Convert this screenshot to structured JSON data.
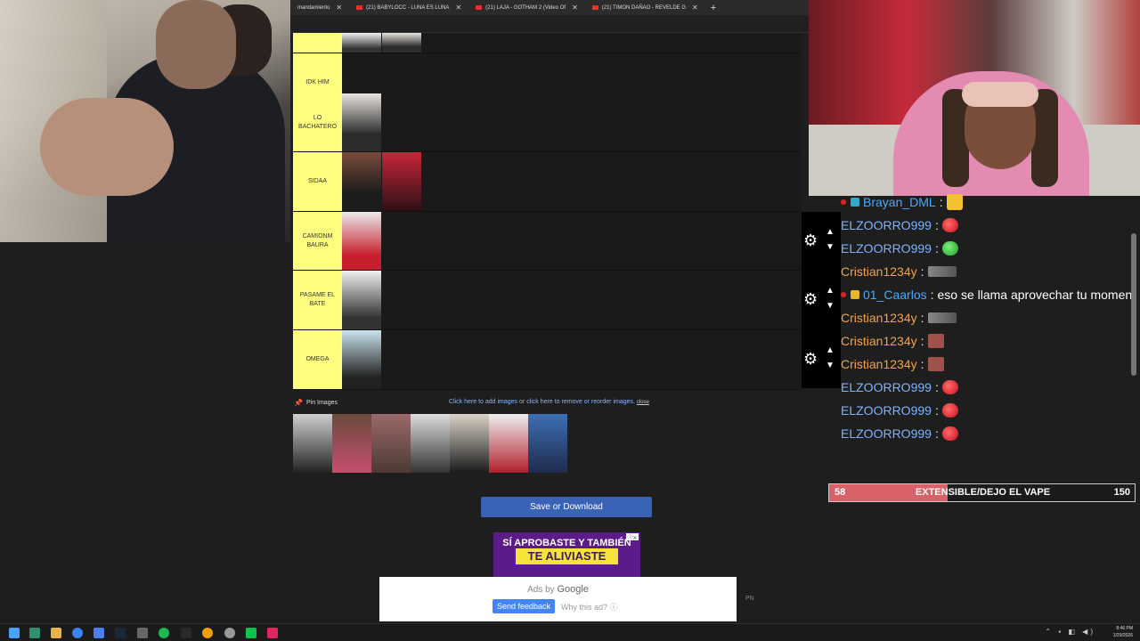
{
  "browser": {
    "tabs": [
      {
        "label": "mandamiento",
        "close": "✕"
      },
      {
        "label": "(21) BABYLOCC - LUNA ES LUNA",
        "close": "✕"
      },
      {
        "label": "(21) LAJA - GOTHAM 2 (Video Of",
        "close": "✕"
      },
      {
        "label": "(21) TIMON DAÑAO - REVELDE G",
        "close": "✕"
      }
    ],
    "new_tab": "+"
  },
  "tierlist": {
    "tiers": [
      {
        "label": ""
      },
      {
        "label": "IDK HIM"
      },
      {
        "label": "LO BACHATERO"
      },
      {
        "label": "SIDAA"
      },
      {
        "label": "CAMIONM BAURA"
      },
      {
        "label": "PASAME EL BATE"
      },
      {
        "label": "OMEGA"
      }
    ],
    "pin_label": "Pin Images",
    "help_add": "Click here to add images",
    "help_or": "or",
    "help_remove": "click here to remove or reorder images.",
    "help_close": "close",
    "save_button": "Save or Download"
  },
  "ad": {
    "line1": "SÍ APROBASTE Y TAMBIÉN",
    "line2": "TE ALIVIASTE",
    "ads_by": "Ads by",
    "google": "Google",
    "send_feedback": "Send feedback",
    "why_ad": "Why this ad? ⓘ",
    "pn": "PN"
  },
  "chat": {
    "messages": [
      {
        "user": "Brayan_DML",
        "color": "#4aa8ff",
        "message": ""
      },
      {
        "user": "ELZOORRO999",
        "color": "#7fb3ff",
        "message": ""
      },
      {
        "user": "ELZOORRO999",
        "color": "#7fb3ff",
        "message": ""
      },
      {
        "user": "Cristian1234y",
        "color": "#f0a44b",
        "message": ""
      },
      {
        "user": "01_Caarlos",
        "color": "#4aa8ff",
        "message": "eso se llama aprovechar tu momen"
      },
      {
        "user": "Cristian1234y",
        "color": "#f0a44b",
        "message": ""
      },
      {
        "user": "Cristian1234y",
        "color": "#f0a44b",
        "message": ""
      },
      {
        "user": "Cristian1234y",
        "color": "#f0a44b",
        "message": ""
      },
      {
        "user": "ELZOORRO999",
        "color": "#7fb3ff",
        "message": ""
      },
      {
        "user": "ELZOORRO999",
        "color": "#7fb3ff",
        "message": ""
      },
      {
        "user": "ELZOORRO999",
        "color": "#7fb3ff",
        "message": ""
      }
    ],
    "colon": ":"
  },
  "goal": {
    "start": "58",
    "title": "EXTENSIBLE/DEJO EL VAPE",
    "end": "150",
    "progress_fraction": 0.387
  },
  "taskbar": {
    "time": "8:46 PM",
    "date": "1/29/2026"
  }
}
